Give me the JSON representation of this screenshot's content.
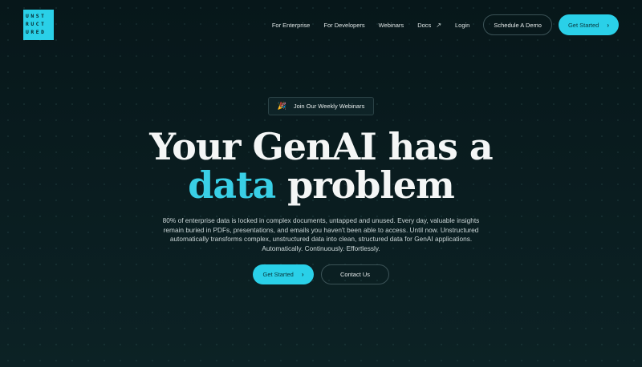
{
  "logo": {
    "lines": [
      "UNST",
      "RUCT",
      "URED"
    ]
  },
  "nav": {
    "links": [
      "For Enterprise",
      "For Developers",
      "Webinars",
      "Docs"
    ],
    "docs_icon": "external-arrow-icon",
    "login": "Login",
    "schedule_demo": "Schedule A Demo",
    "get_started": "Get Started"
  },
  "hero": {
    "pill_icon": "party-popper-icon",
    "pill_label": "Join Our Weekly Webinars",
    "headline_line1": "Your GenAI has a",
    "headline_accent": "data",
    "headline_rest": " problem",
    "subtext": "80% of enterprise data is locked in complex documents, untapped and unused. Every day, valuable insights remain buried in PDFs, presentations, and emails you haven't been able to access. Until now. Unstructured automatically transforms complex, unstructured data into clean, structured data for GenAI applications. Automatically. Continuously. Effortlessly.",
    "cta_primary": "Get Started",
    "cta_secondary": "Contact Us"
  },
  "colors": {
    "accent": "#2ad0e8",
    "background": "#08191b"
  }
}
